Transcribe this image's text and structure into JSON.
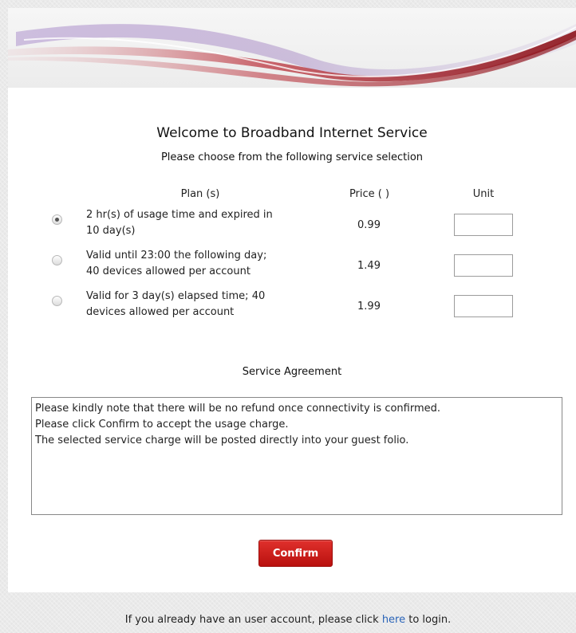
{
  "header": {
    "welcome_title": "Welcome to Broadband Internet Service",
    "subtitle": "Please choose from the following service selection"
  },
  "plans_table": {
    "columns": {
      "plan": "Plan (s)",
      "price": "Price ( )",
      "unit": "Unit"
    },
    "rows": [
      {
        "line1": "2 hr(s) of usage time and expired in",
        "line2": "10 day(s)",
        "price": "0.99",
        "selected": true,
        "unit_value": ""
      },
      {
        "line1": "Valid until 23:00 the following day;",
        "line2": "40 devices allowed per account",
        "price": "1.49",
        "selected": false,
        "unit_value": ""
      },
      {
        "line1": "Valid for 3 day(s) elapsed time; 40",
        "line2": "devices allowed per account",
        "price": "1.99",
        "selected": false,
        "unit_value": ""
      }
    ]
  },
  "agreement": {
    "title": "Service Agreement",
    "lines": [
      "Please kindly note that there will be no refund once connectivity is confirmed.",
      "Please click Confirm to accept the usage charge.",
      "The selected service charge will be posted directly into your guest folio."
    ]
  },
  "confirm_label": "Confirm",
  "footer": {
    "text_before": "If you already have an user account, please click ",
    "link_text": "here",
    "text_after": " to login."
  },
  "colors": {
    "accent_red": "#c0151a",
    "link_blue": "#2a64b8",
    "banner_swoosh": "#a31d24",
    "banner_lavender": "#b8a3cf"
  }
}
